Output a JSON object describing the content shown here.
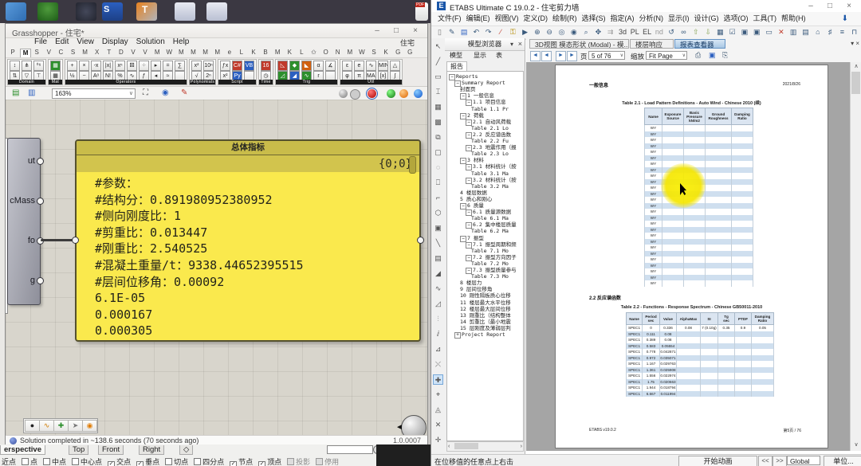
{
  "taskbar": {
    "icons": [
      "display-icon",
      "tree-icon",
      "clock-icon",
      "sap-icon",
      "tekla-icon",
      "rhino-doc-icon",
      "rhino-doc-icon",
      "pdf-icon"
    ]
  },
  "grasshopper": {
    "title": "Grasshopper - 住宅*",
    "window_buttons": [
      "–",
      "□",
      "×"
    ],
    "menus": [
      "File",
      "Edit",
      "View",
      "Display",
      "Solution",
      "Help"
    ],
    "title_right": "住宅",
    "tab_letters": [
      "P",
      "M",
      "S",
      "V",
      "C",
      "S",
      "M",
      "X",
      "T",
      "D",
      "V",
      "V",
      "M",
      "W",
      "M",
      "M",
      "M",
      "M",
      "e",
      "L",
      "K",
      "B",
      "M",
      "K",
      "L",
      "✩",
      "O",
      "N",
      "M",
      "W",
      "S",
      "K",
      "G",
      "G"
    ],
    "selected_tab_index": 1,
    "toolbar_groups": [
      {
        "label": "Domain",
        "cols": 3,
        "cells": [
          "↕",
          "⋔",
          "⁰⁶",
          "⇅",
          "▽",
          "⊤"
        ]
      },
      {
        "label": "Mat",
        "cols": 1,
        "cells": [
          {
            "g": "▦",
            "c": "#2d8f2d"
          },
          "▦"
        ]
      },
      {
        "label": "Operators",
        "cols": 10,
        "cells": [
          "+",
          "×",
          "-x",
          "|x|",
          "xⁿ",
          "⚄",
          "⁘",
          "▸",
          "=",
          "∑",
          "½",
          "−",
          "Aᵒ",
          "N!",
          "%",
          "∿",
          "ƒ",
          "◂",
          "≈",
          ""
        ]
      },
      {
        "label": "Polynomials",
        "cols": 2,
        "cells": [
          "x²",
          "10ⁿ",
          "√",
          "2ⁿ"
        ]
      },
      {
        "label": "Script",
        "cols": 3,
        "cells": [
          "ƒx",
          {
            "g": "C#",
            "c": "#c03a2b"
          },
          {
            "g": "VB",
            "c": "#2b5fc0"
          },
          "x²",
          {
            "g": "Py",
            "c": "#2b5fc0"
          },
          ""
        ]
      },
      {
        "label": "Time",
        "cols": 1,
        "cells": [
          {
            "g": "16",
            "c": "#c03a2b"
          },
          "◷"
        ]
      },
      {
        "label": "Trig",
        "cols": 5,
        "cells": [
          {
            "g": "◺",
            "c": "#c03a2b"
          },
          {
            "g": "◆",
            "c": "#2d8f2d"
          },
          {
            "g": "◣",
            "c": "#d06010"
          },
          "α",
          "∡",
          {
            "g": "◿",
            "c": "#2d8f2d"
          },
          {
            "g": "◢",
            "c": "#2b5fc0"
          },
          {
            "g": "∿",
            "c": "#2d8f2d"
          },
          "r",
          ""
        ]
      },
      {
        "label": "Util",
        "cols": 5,
        "cells": [
          "ε",
          "e",
          "∿",
          "MIN",
          "△",
          "φ",
          "π",
          "MAX",
          "[x]",
          "∫"
        ]
      }
    ],
    "canvasbar": {
      "zoom": "163%"
    },
    "component": {
      "ports": [
        "ut",
        "cMass",
        "fo",
        "g"
      ]
    },
    "panel": {
      "title": "总体指标",
      "path": "{0;0}",
      "lines": [
        "#参数：",
        "#结构分：0.891980952380952",
        "#侧向刚度比：1",
        "#剪重比：0.013447",
        "#刚重比：2.540525",
        "#混凝土重量/t：9338.44652395515",
        "#层间位移角：0.00092",
        "6.1E-05",
        "0.000167",
        "0.000305"
      ]
    },
    "minibar_icons": [
      "record-icon",
      "sketch-icon",
      "add-icon",
      "pointer-icon",
      "alert-icon"
    ],
    "status": {
      "text": "Solution completed in ~138.6 seconds (70 seconds ago)",
      "version": "1.0.0007"
    }
  },
  "rhino": {
    "viewport_tabs": [
      "erspective",
      "Top",
      "Front",
      "Right",
      "◇"
    ],
    "active_viewport": 0,
    "osnap_label": "近点",
    "osnap": [
      {
        "label": "点",
        "checked": false
      },
      {
        "label": "中点",
        "checked": false
      },
      {
        "label": "中心点",
        "checked": false
      },
      {
        "label": "交点",
        "checked": true
      },
      {
        "label": "垂点",
        "checked": true
      },
      {
        "label": "切点",
        "checked": false
      },
      {
        "label": "四分点",
        "checked": false
      },
      {
        "label": "节点",
        "checked": true
      },
      {
        "label": "顶点",
        "checked": true
      },
      {
        "label": "投影",
        "checked": false,
        "disabled": true
      },
      {
        "label": "停用",
        "checked": false,
        "disabled": true
      }
    ]
  },
  "etabs": {
    "title": "ETABS Ultimate C 19.0.2 - 住宅剪力墙",
    "logo_letter": "E",
    "window_buttons": [
      "–",
      "□",
      "×"
    ],
    "menus": [
      "文件(F)",
      "编辑(E)",
      "视图(V)",
      "定义(D)",
      "绘制(R)",
      "选择(S)",
      "指定(A)",
      "分析(N)",
      "显示(I)",
      "设计(G)",
      "选项(O)",
      "工具(T)",
      "帮助(H)"
    ],
    "toolbar_icons": [
      {
        "g": "▯",
        "c": "#7a7a7a"
      },
      {
        "g": "✎",
        "c": "#3a5a7c"
      },
      {
        "g": "▤",
        "c": "#2b5fc0"
      },
      {
        "g": "↶",
        "c": "#3a5a7c"
      },
      {
        "g": "↷",
        "c": "#3a5a7c"
      },
      {
        "g": "∕",
        "c": "#c03a2b"
      },
      {
        "g": "⚿",
        "c": "#b58a00"
      },
      {
        "g": "▶",
        "c": "#3a5a7c"
      },
      {
        "g": "⊕",
        "c": "#3a5a7c"
      },
      {
        "g": "⊖",
        "c": "#3a5a7c"
      },
      {
        "g": "◎",
        "c": "#3a5a7c"
      },
      {
        "g": "◉",
        "c": "#3a5a7c"
      },
      {
        "g": "⌕",
        "c": "#3a5a7c"
      },
      {
        "g": "✥",
        "c": "#3a5a7c"
      },
      {
        "g": "⇉",
        "c": "#999999"
      },
      {
        "g": "3d",
        "c": "#444444"
      },
      {
        "g": "PL",
        "c": "#444444"
      },
      {
        "g": "EL",
        "c": "#444444"
      },
      {
        "g": "nd",
        "c": "#999999"
      },
      {
        "g": "↺",
        "c": "#3a5a7c"
      },
      {
        "g": "∞",
        "c": "#3a5a7c"
      },
      {
        "g": "⇧",
        "c": "#8aa65a"
      },
      {
        "g": "⇩",
        "c": "#8aa65a"
      },
      {
        "g": "▦",
        "c": "#3a5a7c"
      },
      {
        "g": "☑",
        "c": "#3a5a7c"
      },
      {
        "g": "▣",
        "c": "#3a5a7c"
      },
      {
        "g": "▣",
        "c": "#3a5a7c"
      },
      {
        "g": "▭",
        "c": "#3a5a7c"
      },
      {
        "g": "✕",
        "c": "#c03a2b"
      },
      {
        "g": "▥",
        "c": "#3a5a7c"
      },
      {
        "g": "▤",
        "c": "#3a5a7c"
      },
      {
        "g": "⌂",
        "c": "#3a5a7c"
      },
      {
        "g": "♯",
        "c": "#3a5a7c"
      },
      {
        "g": "≡",
        "c": "#3a5a7c"
      },
      {
        "g": "⊓",
        "c": "#3a5a7c"
      }
    ],
    "strip_icons": [
      "↖",
      "╱",
      "▭",
      "⌶",
      "▦",
      "▩",
      "⧉",
      "▢",
      "◌",
      "⎕",
      "⌐",
      "⬡",
      "▣",
      "╲",
      "▤",
      "◢",
      "∿",
      "◿",
      "⫶",
      "ⅈ",
      "⊿",
      "⤬",
      "✚",
      "⌖",
      "◬",
      "✕",
      "✛"
    ],
    "strip_highlight_index": 22,
    "dock": {
      "title": "模型浏览器",
      "menu_arrow": "▾",
      "close": "×",
      "tabs": [
        "模型",
        "显示",
        "表"
      ],
      "sub_tab": "报告",
      "tree": [
        {
          "label": "Reports",
          "level": 0,
          "exp": "-"
        },
        {
          "label": "Summary Report",
          "level": 1,
          "exp": "-"
        },
        {
          "label": "封面页",
          "level": 2,
          "exp": ""
        },
        {
          "label": "1 一般信息",
          "level": 2,
          "exp": "-"
        },
        {
          "label": "1.1 项目信息",
          "level": 3,
          "exp": "-"
        },
        {
          "label": "Table 1.1 Pr",
          "level": 4,
          "exp": ""
        },
        {
          "label": "2 荷载",
          "level": 2,
          "exp": "-"
        },
        {
          "label": "2.1 自动风荷载",
          "level": 3,
          "exp": "-"
        },
        {
          "label": "Table 2.1 Lo",
          "level": 4,
          "exp": ""
        },
        {
          "label": "2.2 反应谱函数",
          "level": 3,
          "exp": "-"
        },
        {
          "label": "Table 2.2 Fu",
          "level": 4,
          "exp": ""
        },
        {
          "label": "2.3 地震作用（报",
          "level": 3,
          "exp": "-"
        },
        {
          "label": "Table 2.3 Lo",
          "level": 4,
          "exp": ""
        },
        {
          "label": "3 材料",
          "level": 2,
          "exp": "-"
        },
        {
          "label": "3.1 材料统计（按",
          "level": 3,
          "exp": "-"
        },
        {
          "label": "Table 3.1 Ma",
          "level": 4,
          "exp": ""
        },
        {
          "label": "3.2 材料统计（按",
          "level": 3,
          "exp": "-"
        },
        {
          "label": "Table 3.2 Ma",
          "level": 4,
          "exp": ""
        },
        {
          "label": "4 楼层数据",
          "level": 2,
          "exp": ""
        },
        {
          "label": "5 质心和刚心",
          "level": 2,
          "exp": ""
        },
        {
          "label": "6 质量",
          "level": 2,
          "exp": "-"
        },
        {
          "label": "6.1 质量源数据",
          "level": 3,
          "exp": "-"
        },
        {
          "label": "Table 6.1 Ma",
          "level": 4,
          "exp": ""
        },
        {
          "label": "6.2 集中楼层质量",
          "level": 3,
          "exp": "-"
        },
        {
          "label": "Table 6.2 Ma",
          "level": 4,
          "exp": ""
        },
        {
          "label": "7 振型",
          "level": 2,
          "exp": "-"
        },
        {
          "label": "7.1 振型周期和频",
          "level": 3,
          "exp": "-"
        },
        {
          "label": "Table 7.1 Mo",
          "level": 4,
          "exp": ""
        },
        {
          "label": "7.2 振型方向因子",
          "level": 3,
          "exp": "-"
        },
        {
          "label": "Table 7.2 Mo",
          "level": 4,
          "exp": ""
        },
        {
          "label": "7.3 振型质量参与",
          "level": 3,
          "exp": "-"
        },
        {
          "label": "Table 7.3 Mo",
          "level": 4,
          "exp": ""
        },
        {
          "label": "8 楼层力",
          "level": 2,
          "exp": ""
        },
        {
          "label": "9 层间位移角",
          "level": 2,
          "exp": ""
        },
        {
          "label": "10 刚性隔板质心位移",
          "level": 2,
          "exp": ""
        },
        {
          "label": "11 楼层最大水平位移",
          "level": 2,
          "exp": ""
        },
        {
          "label": "12 楼层最大层间位移",
          "level": 2,
          "exp": ""
        },
        {
          "label": "13 刚重比（结构整体",
          "level": 2,
          "exp": ""
        },
        {
          "label": "14 剪重比（最小地震",
          "level": 2,
          "exp": ""
        },
        {
          "label": "15 层刚度及薄弱层判",
          "level": 2,
          "exp": ""
        },
        {
          "label": "Project Report",
          "level": 1,
          "exp": "+"
        }
      ]
    },
    "main_tabs": [
      {
        "label": "3D视图 模态形状 (Modal) - 模...",
        "sel": false
      },
      {
        "label": "楼层响应",
        "sel": false
      },
      {
        "label": "报表查看器",
        "sel": true
      }
    ],
    "report_toolbar": {
      "page_label": "页",
      "page_value": "5 of 76",
      "zoom_label": "缩放",
      "zoom_value": "Fit Page"
    },
    "report": {
      "heading": "一般信息",
      "date": "2021/8/26",
      "table1": {
        "title": "Table 2.1 - Load Pattern Definitions - Auto Wind - Chinese 2010 (续)",
        "columns": [
          "Name",
          "Exposure\nSource",
          "Basic\nPressure\nkN/m2",
          "Ground\nRoughness",
          "Damping\nRatio"
        ],
        "rows": [
          [
            "WY"
          ],
          [
            "WY"
          ],
          [
            "WY"
          ],
          [
            "WY"
          ],
          [
            "WY"
          ],
          [
            "WY"
          ],
          [
            "WY"
          ],
          [
            "WY"
          ],
          [
            "WY"
          ],
          [
            "WY"
          ],
          [
            "WY"
          ],
          [
            "WY"
          ],
          [
            "WY"
          ],
          [
            "WY"
          ],
          [
            "WY"
          ],
          [
            "WY"
          ],
          [
            "WY"
          ],
          [
            "WY"
          ],
          [
            "WY"
          ],
          [
            "WY"
          ],
          [
            "WY"
          ],
          [
            "WY"
          ],
          [
            "WY"
          ],
          [
            "WY"
          ],
          [
            "WY"
          ],
          [
            "WY"
          ],
          [
            "WY"
          ]
        ]
      },
      "section2": "2.2 反应谱函数",
      "table2": {
        "title": "Table 2.2 - Functions - Response Spectrum - Chinese GB50011-2010",
        "columns": [
          "Name",
          "Period\nsec",
          "Value",
          "AlphaMax",
          "SI",
          "Tg\nsec",
          "PTDF",
          "Damping\nRatio"
        ],
        "rows": [
          [
            "SPEC1",
            "0",
            "0.336",
            "0.08",
            "7 (0.10g)",
            "0.35",
            "0.9",
            "0.05"
          ],
          [
            "SPEC1",
            "0.111",
            "0.08",
            "",
            "",
            "",
            "",
            ""
          ],
          [
            "SPEC1",
            "0.389",
            "0.08",
            "",
            "",
            "",
            "",
            ""
          ],
          [
            "SPEC1",
            "0.583",
            "0.05554",
            "",
            "",
            "",
            "",
            ""
          ],
          [
            "SPEC1",
            "0.778",
            "0.042871",
            "",
            "",
            "",
            "",
            ""
          ],
          [
            "SPEC1",
            "0.972",
            "0.035071",
            "",
            "",
            "",
            "",
            ""
          ],
          [
            "SPEC1",
            "1.167",
            "0.029763",
            "",
            "",
            "",
            "",
            ""
          ],
          [
            "SPEC1",
            "1.361",
            "0.025908",
            "",
            "",
            "",
            "",
            ""
          ],
          [
            "SPEC1",
            "1.556",
            "0.022974",
            "",
            "",
            "",
            "",
            ""
          ],
          [
            "SPEC1",
            "1.75",
            "0.020663",
            "",
            "",
            "",
            "",
            ""
          ],
          [
            "SPEC1",
            "1.944",
            "0.018794",
            "",
            "",
            "",
            "",
            ""
          ],
          [
            "SPEC1",
            "6.667",
            "0.011994",
            "",
            "",
            "",
            "",
            ""
          ]
        ]
      },
      "footer_left": "ETABS v19.0.2",
      "footer_right": "第5页 / 76"
    },
    "status": {
      "hint": "在位移值的任意点上右击",
      "animate": "开始动画",
      "prev": "<<",
      "next": ">>",
      "coord": "Global",
      "units": "单位..."
    }
  }
}
